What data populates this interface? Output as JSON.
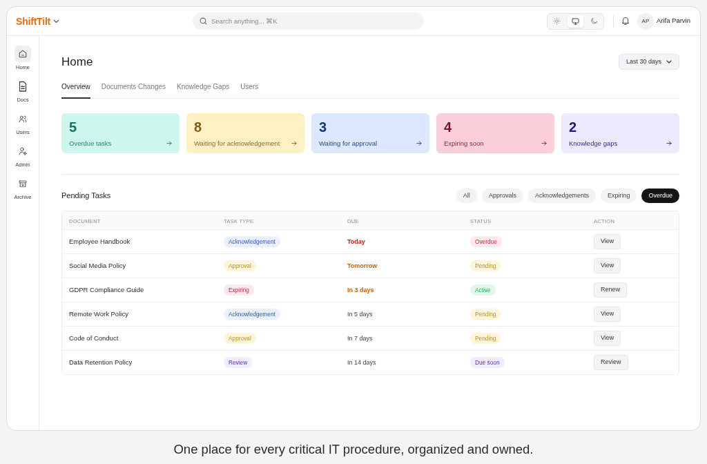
{
  "app": {
    "logo": "ShiftTilt"
  },
  "search": {
    "placeholder": "Search anything... ⌘K"
  },
  "theme_options": [
    {
      "kind": "light",
      "selected": false
    },
    {
      "kind": "system",
      "selected": true
    },
    {
      "kind": "dark",
      "selected": false
    }
  ],
  "user": {
    "initials": "AP",
    "name": "Arifa Parvin"
  },
  "sidebar": {
    "items": [
      {
        "label": "Home",
        "selected": true
      },
      {
        "label": "Docs",
        "selected": false
      },
      {
        "label": "Users",
        "selected": false
      },
      {
        "label": "Admin",
        "selected": false
      },
      {
        "label": "Archive",
        "selected": false
      }
    ]
  },
  "page": {
    "title": "Home",
    "date_range": "Last 30 days"
  },
  "tabs": [
    {
      "label": "Overview",
      "selected": true
    },
    {
      "label": "Documents Changes",
      "selected": false
    },
    {
      "label": "Knowledge Gaps",
      "selected": false
    },
    {
      "label": "Users",
      "selected": false
    }
  ],
  "stats": [
    {
      "value": "5",
      "label": "Overdue tasks",
      "color": "#cdf7ec"
    },
    {
      "value": "8",
      "label": "Waiting for acknowledgement",
      "color": "#fdf0c4"
    },
    {
      "value": "3",
      "label": "Waiting for approval",
      "color": "#dbe8fe"
    },
    {
      "value": "4",
      "label": "Expiring soon",
      "color": "#fbcfd9"
    },
    {
      "value": "2",
      "label": "Knowledge gaps",
      "color": "#ede9fe"
    }
  ],
  "pending_tasks": {
    "title": "Pending Tasks",
    "filters": [
      {
        "label": "All",
        "selected": false
      },
      {
        "label": "Approvals",
        "selected": false
      },
      {
        "label": "Acknowledgements",
        "selected": false
      },
      {
        "label": "Expiring",
        "selected": false
      },
      {
        "label": "Overdue",
        "selected": true
      }
    ],
    "table": {
      "columns": [
        "DOCUMENT",
        "TASK TYPE",
        "DUE",
        "STATUS",
        "ACTION"
      ],
      "rows": [
        {
          "document": "Employee Handbook",
          "task_type": {
            "text": "Acknowledgement",
            "color": "#eaf0fd"
          },
          "due": {
            "text": "Today",
            "kind": "urgent"
          },
          "status": {
            "text": "Overdue",
            "color": "#fde8ec"
          },
          "action": "View"
        },
        {
          "document": "Social Media Policy",
          "task_type": {
            "text": "Approval",
            "color": "#fef5da"
          },
          "due": {
            "text": "Tomorrow",
            "kind": "soon"
          },
          "status": {
            "text": "Pending",
            "color": "#fef5da"
          },
          "action": "View"
        },
        {
          "document": "GDPR Compliance Guide",
          "task_type": {
            "text": "Expiring",
            "color": "#fde8ec"
          },
          "due": {
            "text": "In 3 days",
            "kind": "soon"
          },
          "status": {
            "text": "Active",
            "color": "#e4f6ea"
          },
          "action": "Renew"
        },
        {
          "document": "Remote Work Policy",
          "task_type": {
            "text": "Acknowledgement",
            "color": "#eaf0fd"
          },
          "due": {
            "text": "In 5 days",
            "kind": "normal"
          },
          "status": {
            "text": "Pending",
            "color": "#fef5da"
          },
          "action": "View"
        },
        {
          "document": "Code of Conduct",
          "task_type": {
            "text": "Approval",
            "color": "#fef5da"
          },
          "due": {
            "text": "In 7 days",
            "kind": "normal"
          },
          "status": {
            "text": "Pending",
            "color": "#fef5da"
          },
          "action": "View"
        },
        {
          "document": "Data Retention Policy",
          "task_type": {
            "text": "Review",
            "color": "#f2edfe"
          },
          "due": {
            "text": "In 14 days",
            "kind": "normal"
          },
          "status": {
            "text": "Due soon",
            "color": "#f2edfe"
          },
          "action": "Review"
        }
      ]
    }
  },
  "caption": "One place for every critical IT procedure, organized and owned."
}
